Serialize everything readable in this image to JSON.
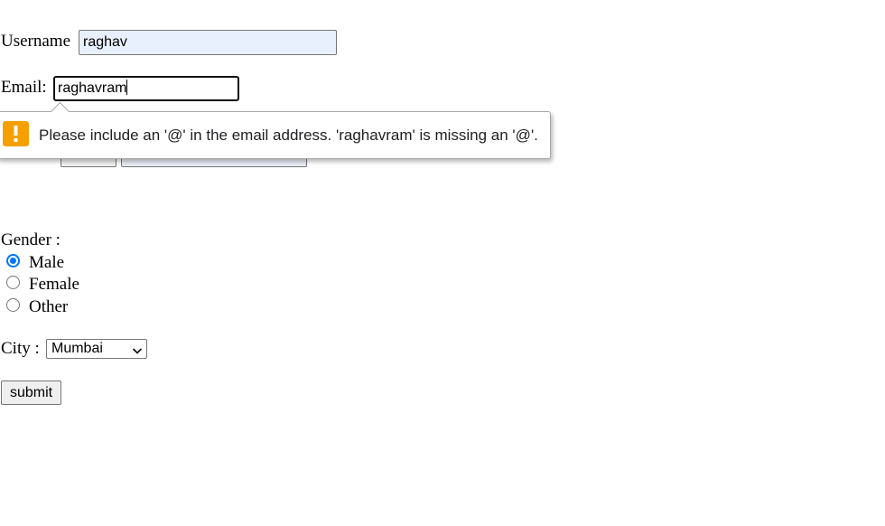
{
  "form": {
    "username": {
      "label": "Username",
      "value": "raghav"
    },
    "email": {
      "label": "Email:",
      "value": "raghavram"
    },
    "validation_message": "Please include an '@' in the email address. 'raghavram' is missing an '@'.",
    "gender": {
      "label": "Gender :",
      "options": [
        {
          "label": "Male",
          "checked": true
        },
        {
          "label": "Female",
          "checked": false
        },
        {
          "label": "Other",
          "checked": false
        }
      ]
    },
    "city": {
      "label": "City :",
      "selected": "Mumbai"
    },
    "submit_label": "submit"
  },
  "icons": {
    "warning": "exclamation-icon",
    "dropdown": "chevron-down-icon"
  },
  "colors": {
    "warning": "#f5a000",
    "radio_accent": "#0075ff",
    "autofill_bg": "#e8f0fe"
  }
}
